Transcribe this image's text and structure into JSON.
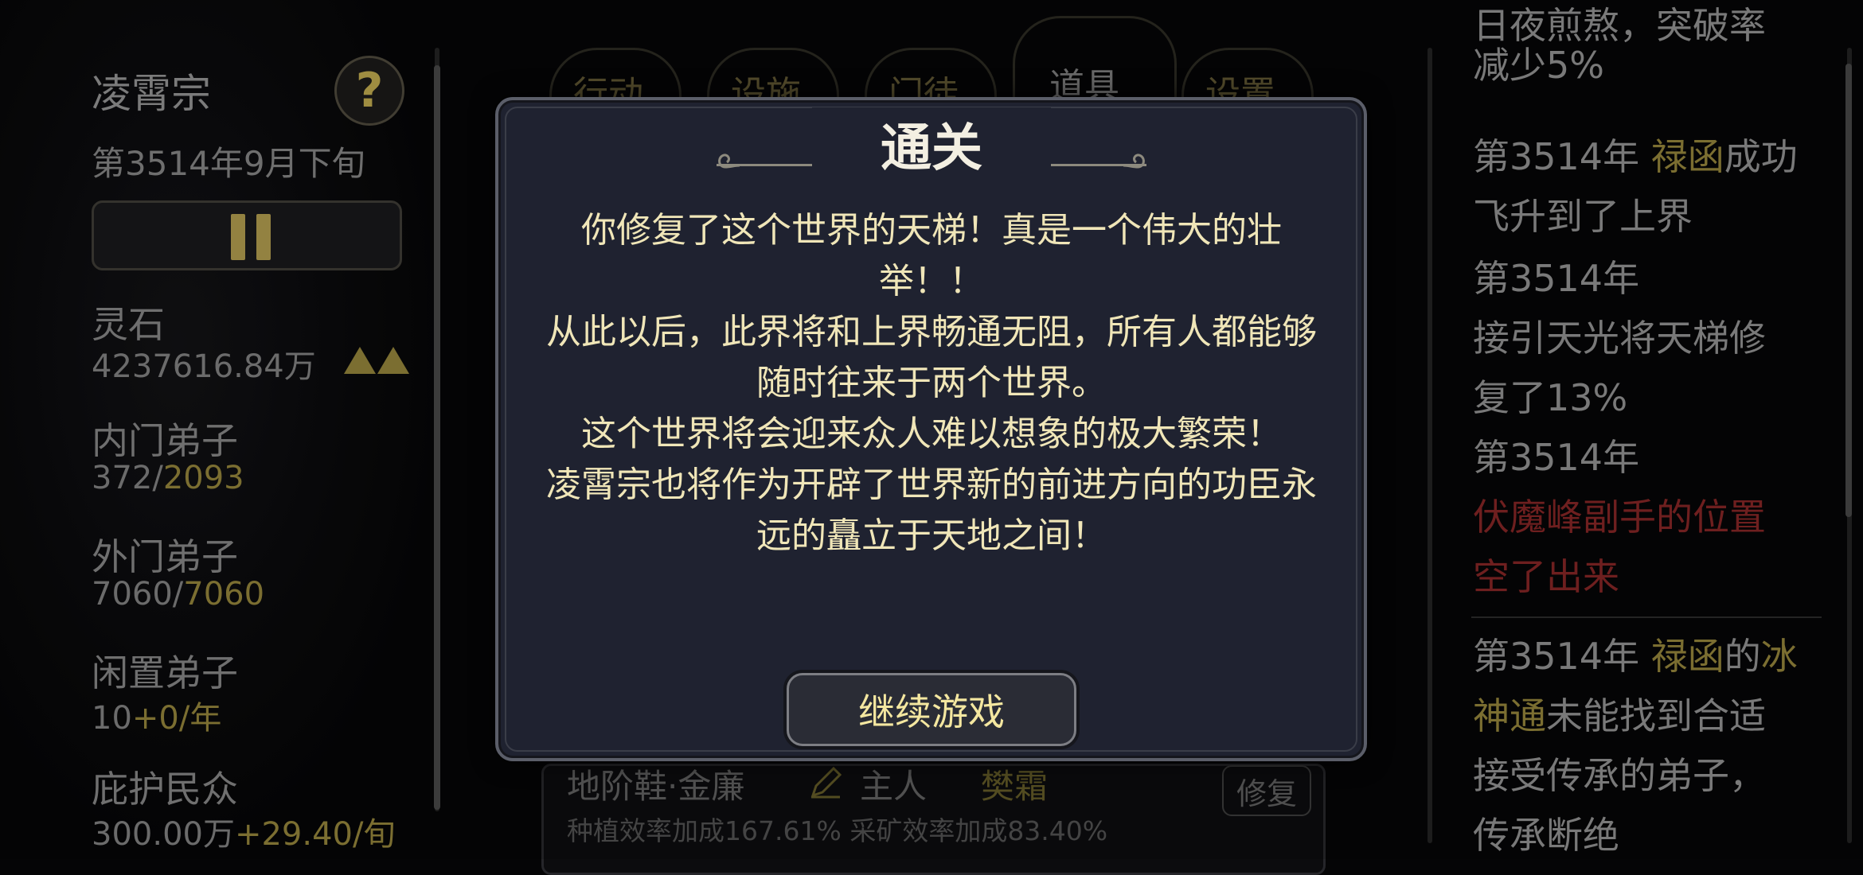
{
  "sidebar": {
    "sect_name": "凌霄宗",
    "help_icon": "question-mark-icon",
    "help_label": "?",
    "date": "第3514年9月下旬",
    "pause_icon": "pause-icon",
    "stats": [
      {
        "label": "灵石",
        "value": "4237616.84万",
        "trend_icon": "double-up-arrow-icon"
      },
      {
        "label": "内门弟子",
        "value": "372/",
        "value_extra": "2093"
      },
      {
        "label": "外门弟子",
        "value": "7060/",
        "value_extra": "7060"
      },
      {
        "label": "闲置弟子",
        "value": "10",
        "value_extra": "+0/年"
      },
      {
        "label": "庇护民众",
        "value": "300.00万",
        "value_extra": "+29.40/旬"
      }
    ]
  },
  "tabs": [
    {
      "label": "行动"
    },
    {
      "label": "设施"
    },
    {
      "label": "门徒"
    },
    {
      "label": "道具",
      "active": true
    },
    {
      "label": "设置"
    }
  ],
  "equipment": {
    "name": "地阶鞋·金廉",
    "owner_label": "主人",
    "owner": "樊霜",
    "desc": "种植效率加成167.61% 采矿效率加成83.40%",
    "repair_label": "修复"
  },
  "log": {
    "lines": [
      [
        {
          "t": "日夜煎熬，突破率"
        }
      ],
      [
        {
          "t": "减少5%"
        }
      ],
      [
        {
          "t": "第3514年 "
        },
        {
          "t": "禄函",
          "c": "gold"
        },
        {
          "t": "成功"
        }
      ],
      [
        {
          "t": "飞升到了上界"
        }
      ],
      [
        {
          "t": "第3514年"
        }
      ],
      [
        {
          "t": "接引天光将天梯修"
        }
      ],
      [
        {
          "t": "复了13%"
        }
      ],
      [
        {
          "t": "第3514年"
        }
      ],
      [
        {
          "t": "伏魔峰副手的位置",
          "c": "red"
        }
      ],
      [
        {
          "t": "空了出来",
          "c": "red"
        }
      ],
      [
        {
          "t": "第3514年 "
        },
        {
          "t": "禄函",
          "c": "gold"
        },
        {
          "t": "的"
        },
        {
          "t": "冰",
          "c": "gold"
        }
      ],
      [
        {
          "t": "神通",
          "c": "gold"
        },
        {
          "t": "未能找到合适"
        }
      ],
      [
        {
          "t": "接受传承的弟子，"
        }
      ],
      [
        {
          "t": "传承断绝"
        }
      ]
    ]
  },
  "modal": {
    "title": "通关",
    "paragraphs": [
      "你修复了这个世界的天梯！真是一个伟大的壮举！！",
      "从此以后，此界将和上界畅通无阻，所有人都能够随时往来于两个世界。",
      "这个世界将会迎来众人难以想象的极大繁荣！",
      "凌霄宗也将作为开辟了世界新的前进方向的功臣永远的矗立于天地之间！"
    ],
    "continue_label": "继续游戏"
  },
  "colors": {
    "gold": "#8c7e38",
    "red": "#7e2424",
    "modal_text": "#f0e6b8",
    "modal_bg": "#1f2230"
  }
}
